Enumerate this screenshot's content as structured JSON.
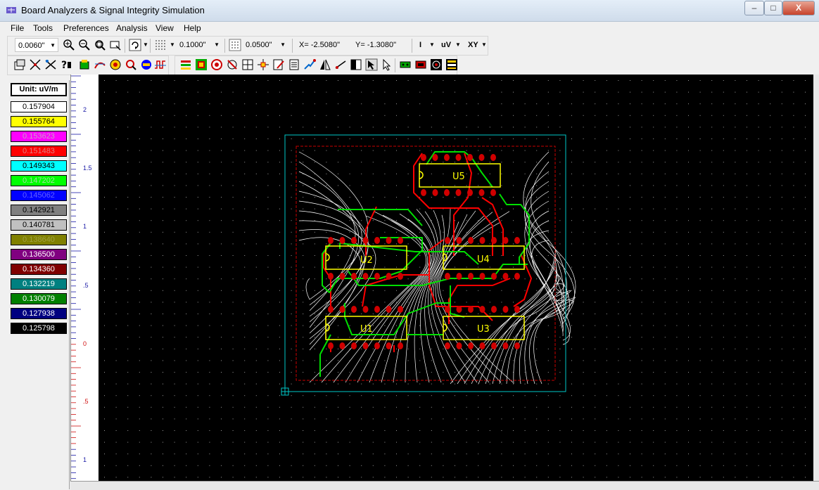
{
  "window": {
    "title": "Board Analyzers & Signal Integrity Simulation",
    "minimize": "–",
    "maximize": "□",
    "close": "X"
  },
  "menu": [
    "File",
    "Tools",
    "Preferences",
    "Analysis",
    "View",
    "Help"
  ],
  "toolbar1": {
    "trace_width": "0.0060\"",
    "grid_value": "0.1000\"",
    "snap_value": "0.0500\"",
    "x_coord": "X= -2.5080\"",
    "y_coord": "Y= -1.3080\"",
    "current_mode": "I",
    "unit": "uV",
    "view_mode": "XY"
  },
  "legend": {
    "unit_label": "Unit: uV/m",
    "items": [
      {
        "value": "0.157904",
        "color": "#ffffff",
        "text": "#000000"
      },
      {
        "value": "0.155764",
        "color": "#ffff00",
        "text": "#000000"
      },
      {
        "value": "0.153623",
        "color": "#ff00ff",
        "text": "#c8a0c8"
      },
      {
        "value": "0.151483",
        "color": "#ff0000",
        "text": "#e08080"
      },
      {
        "value": "0.149343",
        "color": "#00ffff",
        "text": "#000000"
      },
      {
        "value": "0.147202",
        "color": "#00ff00",
        "text": "#a0e0a0"
      },
      {
        "value": "0.145062",
        "color": "#0000ff",
        "text": "#6060ff"
      },
      {
        "value": "0.142921",
        "color": "#808080",
        "text": "#000000"
      },
      {
        "value": "0.140781",
        "color": "#c0c0c0",
        "text": "#000000"
      },
      {
        "value": "0.138640",
        "color": "#808000",
        "text": "#a0a040"
      },
      {
        "value": "0.136500",
        "color": "#800080",
        "text": "#ffffff"
      },
      {
        "value": "0.134360",
        "color": "#800000",
        "text": "#ffffff"
      },
      {
        "value": "0.132219",
        "color": "#008080",
        "text": "#ffffff"
      },
      {
        "value": "0.130079",
        "color": "#008000",
        "text": "#ffffff"
      },
      {
        "value": "0.127938",
        "color": "#000080",
        "text": "#ffffff"
      },
      {
        "value": "0.125798",
        "color": "#000000",
        "text": "#ffffff"
      }
    ]
  },
  "ruler": {
    "labels": [
      "2",
      "1.5",
      "1",
      ".5",
      "0",
      ".5",
      "1"
    ]
  },
  "board": {
    "components": [
      "U5",
      "U2",
      "U4",
      "U1",
      "U3"
    ]
  }
}
